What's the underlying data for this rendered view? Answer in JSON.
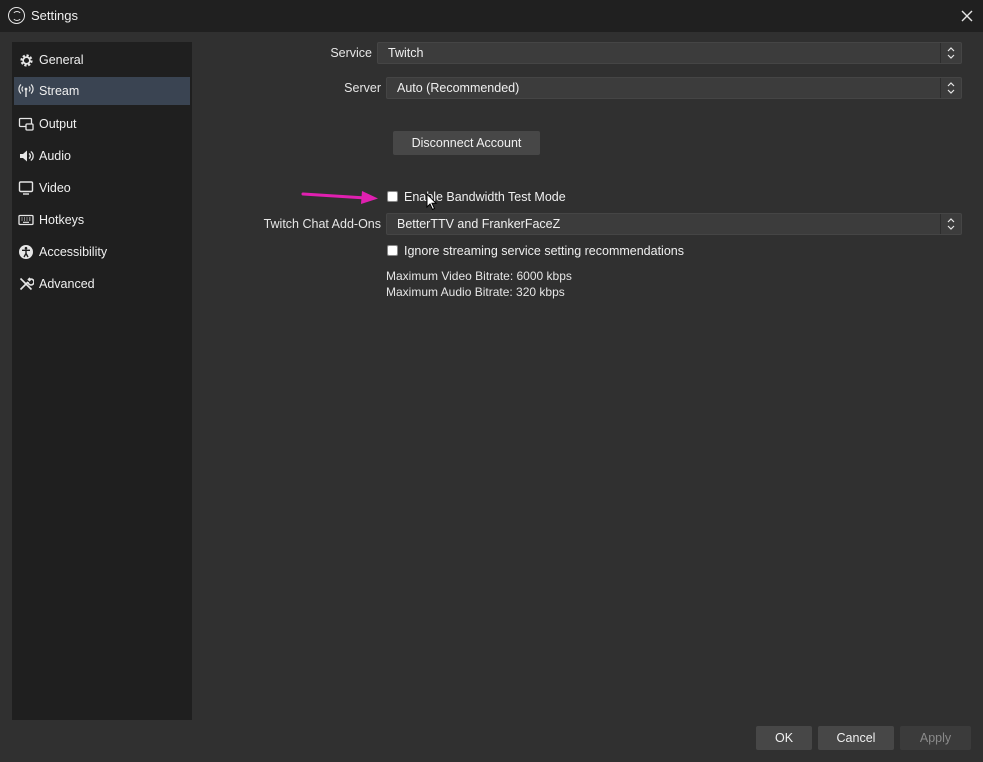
{
  "window": {
    "title": "Settings"
  },
  "sidebar": {
    "items": [
      {
        "label": "General",
        "icon": "gear-icon"
      },
      {
        "label": "Stream",
        "icon": "broadcast-icon",
        "active": true
      },
      {
        "label": "Output",
        "icon": "output-icon"
      },
      {
        "label": "Audio",
        "icon": "speaker-icon"
      },
      {
        "label": "Video",
        "icon": "monitor-icon"
      },
      {
        "label": "Hotkeys",
        "icon": "keyboard-icon"
      },
      {
        "label": "Accessibility",
        "icon": "accessibility-icon"
      },
      {
        "label": "Advanced",
        "icon": "tools-icon"
      }
    ]
  },
  "stream": {
    "service_label": "Service",
    "service_value": "Twitch",
    "server_label": "Server",
    "server_value": "Auto (Recommended)",
    "disconnect_label": "Disconnect Account",
    "bandwidth_label": "Enable Bandwidth Test Mode",
    "addons_label": "Twitch Chat Add-Ons",
    "addons_value": "BetterTTV and FrankerFaceZ",
    "ignore_label": "Ignore streaming service setting recommendations",
    "max_video": "Maximum Video Bitrate: 6000 kbps",
    "max_audio": "Maximum Audio Bitrate: 320 kbps"
  },
  "footer": {
    "ok": "OK",
    "cancel": "Cancel",
    "apply": "Apply"
  },
  "colors": {
    "accent_arrow": "#e020b0",
    "active_item": "#3a4452"
  }
}
